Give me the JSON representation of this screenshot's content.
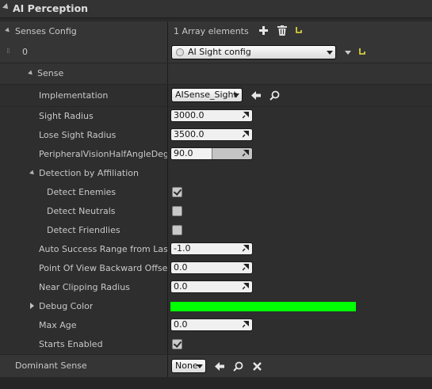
{
  "header": {
    "title": "AI Perception"
  },
  "senses_config": {
    "label": "Senses Config",
    "count": "1 Array elements",
    "element_index": "0",
    "element_value": "AI Sight config"
  },
  "sense": {
    "label": "Sense"
  },
  "props": {
    "implementation": {
      "label": "Implementation",
      "value": "AISense_Sight"
    },
    "sight_radius": {
      "label": "Sight Radius",
      "value": "3000.0"
    },
    "lose_sight_radius": {
      "label": "Lose Sight Radius",
      "value": "3500.0"
    },
    "peripheral": {
      "label": "PeripheralVisionHalfAngleDegrees",
      "value": "90.0",
      "fill": 0.5
    },
    "affiliation": {
      "label": "Detection by Affiliation"
    },
    "detect_enemies": {
      "label": "Detect Enemies",
      "checked": true
    },
    "detect_neutrals": {
      "label": "Detect Neutrals",
      "checked": false
    },
    "detect_friendlies": {
      "label": "Detect Friendlies",
      "checked": false
    },
    "auto_success": {
      "label": "Auto Success Range from Last Seen Location",
      "value": "-1.0"
    },
    "pov_offset": {
      "label": "Point Of View Backward Offset",
      "value": "0.0"
    },
    "near_clip": {
      "label": "Near Clipping Radius",
      "value": "0.0"
    },
    "debug_color": {
      "label": "Debug Color",
      "color": "#00ff00"
    },
    "max_age": {
      "label": "Max Age",
      "value": "0.0"
    },
    "starts_enabled": {
      "label": "Starts Enabled",
      "checked": true
    }
  },
  "dominant": {
    "label": "Dominant Sense",
    "value": "None"
  }
}
